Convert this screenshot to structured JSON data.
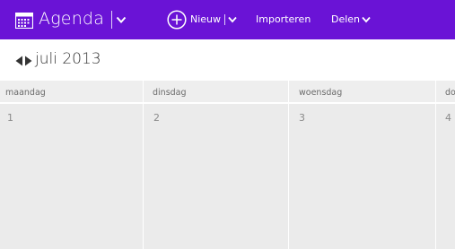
{
  "header": {
    "app_title": "Agenda",
    "new_label": "Nieuw",
    "import_label": "Importeren",
    "share_label": "Delen",
    "accent_color": "#6a13d6"
  },
  "calendar": {
    "month_label": "juli 2013",
    "days": [
      {
        "name": "maandag",
        "date": "1"
      },
      {
        "name": "dinsdag",
        "date": "2"
      },
      {
        "name": "woensdag",
        "date": "3"
      },
      {
        "name": "do",
        "date": "4"
      }
    ]
  },
  "icons": [
    "calendar-icon",
    "chevron-down-icon",
    "plus-circle-icon",
    "arrow-left-icon",
    "arrow-right-icon"
  ]
}
